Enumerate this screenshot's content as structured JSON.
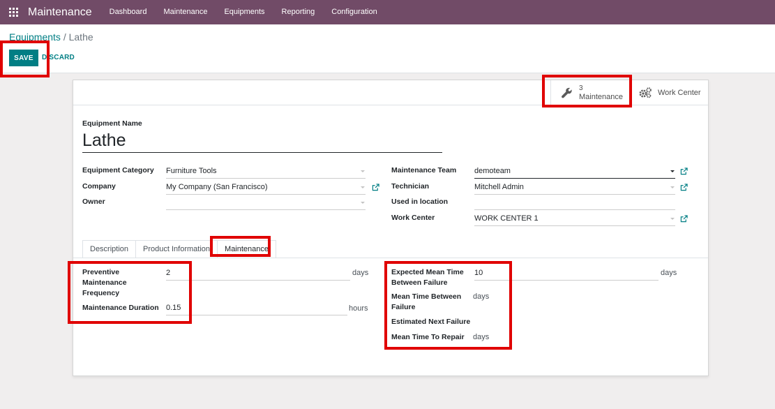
{
  "app": {
    "name": "Maintenance",
    "menu": [
      "Dashboard",
      "Maintenance",
      "Equipments",
      "Reporting",
      "Configuration"
    ]
  },
  "breadcrumb": {
    "parent": "Equipments",
    "separator": "/",
    "current": "Lathe"
  },
  "actions": {
    "save": "SAVE",
    "discard": "DISCARD"
  },
  "smart_buttons": {
    "maintenance": {
      "count": "3",
      "label": "Maintenance",
      "icon": "wrench-icon"
    },
    "work_center": {
      "label": "Work Center",
      "icon": "gears-icon"
    }
  },
  "equipment": {
    "name_label": "Equipment Name",
    "name": "Lathe",
    "category_label": "Equipment Category",
    "category": "Furniture Tools",
    "company_label": "Company",
    "company": "My Company (San Francisco)",
    "owner_label": "Owner",
    "owner": "",
    "team_label": "Maintenance Team",
    "team": "demoteam",
    "technician_label": "Technician",
    "technician": "Mitchell Admin",
    "location_label": "Used in location",
    "location": "",
    "workcenter_label": "Work Center",
    "workcenter": "WORK CENTER 1"
  },
  "tabs": [
    "Description",
    "Product Information",
    "Maintenance"
  ],
  "maintenance_tab": {
    "preventive_label": "Preventive Maintenance Frequency",
    "preventive_value": "2",
    "preventive_unit": "days",
    "duration_label": "Maintenance Duration",
    "duration_value": "0.15",
    "duration_unit": "hours",
    "mtbf_label": "Expected Mean Time Between Failure",
    "mtbf_value": "10",
    "mtbf_unit": "days",
    "mtb_label": "Mean Time Between Failure",
    "mtb_unit": "days",
    "next_failure_label": "Estimated Next Failure",
    "mttr_label": "Mean Time To Repair",
    "mttr_unit": "days"
  },
  "colors": {
    "topbar": "#714b67",
    "primary": "#017e84",
    "highlight": "#e00000"
  }
}
